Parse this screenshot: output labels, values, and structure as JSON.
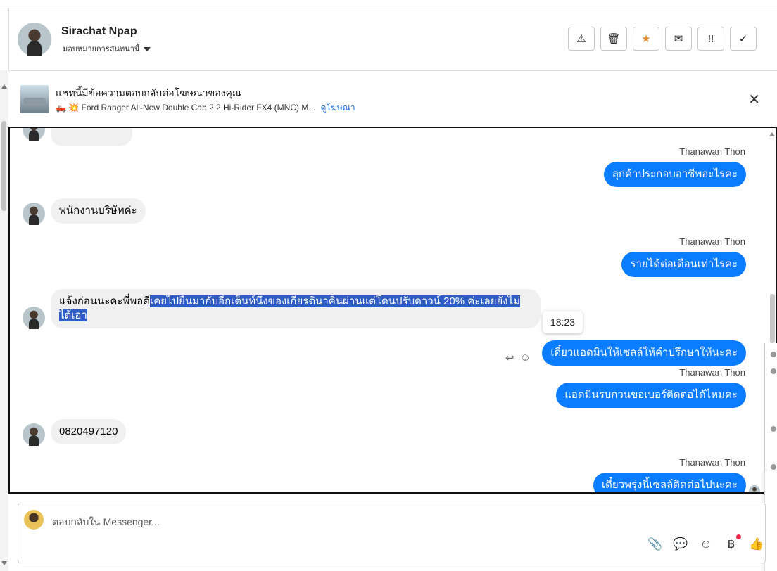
{
  "header": {
    "name": "Sirachat Npap",
    "assign_label": "มอบหมายการสนทนานี้",
    "buttons": [
      {
        "icon": "warning-icon",
        "glyph": "⚠"
      },
      {
        "icon": "trash-icon",
        "glyph": "🗑"
      },
      {
        "icon": "star-icon",
        "glyph": "★"
      },
      {
        "icon": "mail-icon",
        "glyph": "✉"
      },
      {
        "icon": "priority-icon",
        "glyph": "!!"
      },
      {
        "icon": "check-icon",
        "glyph": "✓"
      }
    ]
  },
  "ad_banner": {
    "title": "แชทนี้มีข้อความตอบกลับต่อโฆษณาของคุณ",
    "subtitle": "🛻 💥 Ford Ranger All-New Double Cab 2.2 Hi-Rider FX4 (MNC) M...",
    "link": "ดูโฆษณา",
    "close_glyph": "✕"
  },
  "messages": {
    "m1_sender": "Thanawan Thon",
    "m1_text": "ลุกค้าประกอบอาชีพอะไรคะ",
    "m2_text": "พนักงานบริษัทค่ะ",
    "m3_sender": "Thanawan Thon",
    "m3_text": "รายได้ต่อเดือนเท่าไรคะ",
    "m4_text_plain": "แจ้งก่อนนะคะพี่พอดี",
    "m4_text_highlight": "เคยไปยื่นมากับอีกเต็นท์นึงของเกียรตินาคินผ่านแต่โดนปรับดาวน์ 20% ค่ะเลยยังไม่ได้เอา",
    "tooltip_time": "18:23",
    "m5_text": "เดี๋ยวแอดมินให้เซลล์ให้คำปรึกษาให้นะคะ",
    "m6_sender": "Thanawan Thon",
    "m6_text": "แอดมินรบกวนขอเบอร์ติดต่อได้ไหมคะ",
    "m7_text": "0820497120",
    "m8_sender": "Thanawan Thon",
    "m8_text": "เดี๋ยวพรุ่งนี้เซลล์ติดต่อไปนะคะ"
  },
  "compose": {
    "placeholder": "ตอบกลับใน Messenger...",
    "tools": [
      {
        "icon": "attachment-icon",
        "glyph": "📎"
      },
      {
        "icon": "chat-bubble-icon",
        "glyph": "💬"
      },
      {
        "icon": "emoji-icon",
        "glyph": "☺"
      },
      {
        "icon": "baht-icon",
        "glyph": "฿"
      },
      {
        "icon": "thumbs-up-icon",
        "glyph": "👍"
      }
    ]
  }
}
